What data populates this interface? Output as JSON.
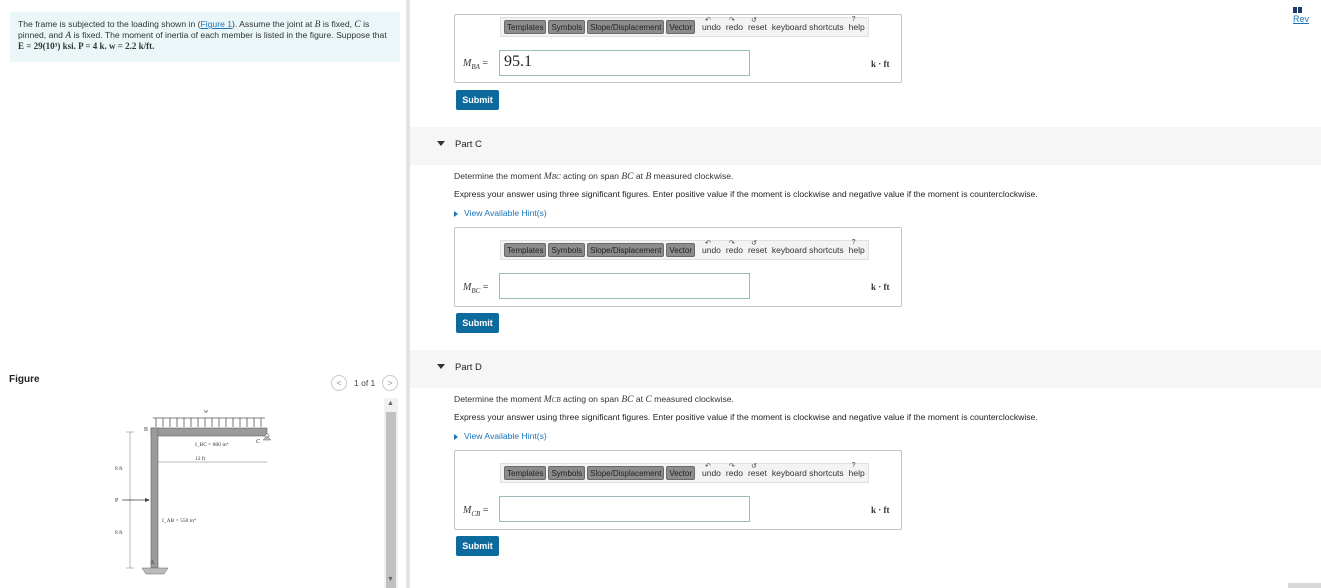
{
  "problem": {
    "line1_a": "The frame is subjected to the loading shown in (",
    "figure_link": "Figure 1",
    "line1_b": "). Assume the joint at ",
    "var_B": "B",
    "line1_c": " is fixed, ",
    "var_C": "C",
    "line1_d": " is",
    "line2_a": "pinned, and ",
    "var_A": "A",
    "line2_b": " is fixed. The moment of inertia of each member is listed in the figure. Suppose that",
    "line3_E": "E = 29(10³) ksi. P = 4 k. w = 2.2 k/ft."
  },
  "figure": {
    "title": "Figure",
    "prev_icon": "<",
    "next_icon": ">",
    "count": "1 of 1",
    "labels": {
      "w": "w",
      "B": "B",
      "C": "C",
      "A": "A",
      "P": "P",
      "ibc": "I_BC = 800 in⁴",
      "iab": "I_AB = 550 in⁴",
      "span": "12 ft",
      "h1": "8 ft",
      "h2": "8 ft"
    }
  },
  "header": {
    "reset_link": "Rev"
  },
  "toolbar": {
    "templates": "Templates",
    "symbols": "Symbols",
    "slope": "Slope/Displacement",
    "vector": "Vector",
    "undo": "undo",
    "redo": "redo",
    "reset": "reset",
    "shortcuts": "keyboard shortcuts",
    "help": "help"
  },
  "partB": {
    "label_var": "M",
    "label_sub": "BA",
    "equals": "=",
    "value": "95.1",
    "unit": "k · ft",
    "submit": "Submit"
  },
  "partC": {
    "title": "Part C",
    "prompt_a": "Determine the moment ",
    "prompt_var": "M",
    "prompt_sub": "BC",
    "prompt_b": " acting on span ",
    "prompt_span": "BC",
    "prompt_c": " at ",
    "prompt_pt": "B",
    "prompt_d": " measured clockwise.",
    "instruction": "Express your answer using three significant figures. Enter positive value if the moment is clockwise and negative value if the moment is counterclockwise.",
    "hint": "View Available Hint(s)",
    "label_var": "M",
    "label_sub": "BC",
    "equals": "=",
    "value": "",
    "unit": "k · ft",
    "submit": "Submit"
  },
  "partD": {
    "title": "Part D",
    "prompt_a": "Determine the moment ",
    "prompt_var": "M",
    "prompt_sub": "CB",
    "prompt_b": " acting on span ",
    "prompt_span": "BC",
    "prompt_c": " at ",
    "prompt_pt": "C",
    "prompt_d": " measured clockwise.",
    "instruction": "Express your answer using three significant figures. Enter positive value if the moment is clockwise and negative value if the moment is counterclockwise.",
    "hint": "View Available Hint(s)",
    "label_var": "M",
    "label_sub": "CB",
    "equals": "=",
    "value": "",
    "unit": "k · ft",
    "submit": "Submit"
  },
  "icons": {
    "collapse": "caret-down-icon",
    "hint": "caret-right-icon"
  },
  "colors": {
    "accent": "#0c6b9c",
    "link": "#1a73b8",
    "problem_bg": "#eaf6f8"
  }
}
